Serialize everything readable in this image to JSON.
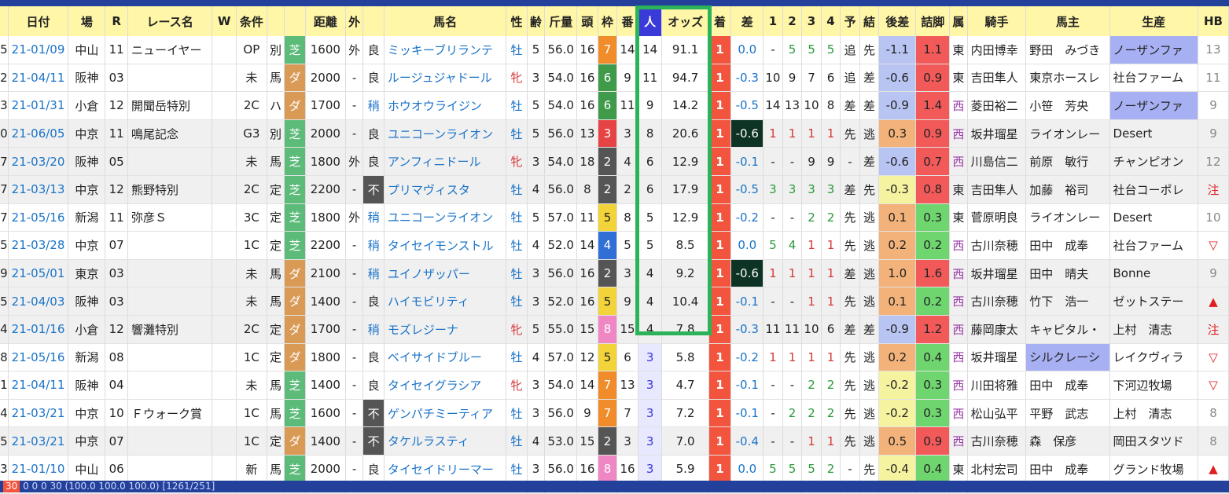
{
  "header": {
    "cols": [
      "",
      "日付",
      "場",
      "R",
      "レース名",
      "W",
      "条件",
      "",
      "",
      "距離",
      "外",
      "",
      "馬名",
      "性",
      "齢",
      "斤量",
      "頭",
      "枠",
      "番",
      "人",
      "オッズ",
      "着",
      "差",
      "1",
      "2",
      "3",
      "4",
      "予",
      "結",
      "後差",
      "詰脚",
      "属",
      "騎手",
      "馬主",
      "生産",
      "HB"
    ]
  },
  "rows": [
    {
      "i": "5",
      "date": "21-01/09",
      "place": "中山",
      "r": "11",
      "race": "ニューイヤー",
      "w": "",
      "cls": "OP",
      "cond": "別",
      "trk": "芝",
      "dist": "1600",
      "out": "外",
      "baba": "良",
      "horse": "ミッキーブリランテ",
      "sex": "牡",
      "age": "5",
      "kin": "56.0",
      "tou": "16",
      "waku": "7",
      "ban": "14",
      "nin": "14",
      "odds": "91.1",
      "chaku": "1",
      "sa": "0.0",
      "p1": "-",
      "p2": "5",
      "p3": "5",
      "p4": "5",
      "yo": "追",
      "ke": "先",
      "kosa": "-1.1",
      "tsume": "1.1",
      "zoku": "東",
      "jockey": "内田博幸",
      "owner": "野田　みづき",
      "breeder": "ノーザンファ",
      "hb": "13"
    },
    {
      "i": "2",
      "date": "21-04/11",
      "place": "阪神",
      "r": "03",
      "race": "",
      "w": "",
      "cls": "未",
      "cond": "馬",
      "trk": "ダ",
      "dist": "2000",
      "out": "-",
      "baba": "良",
      "horse": "ルージュジャドール",
      "sex": "牝",
      "age": "3",
      "kin": "54.0",
      "tou": "16",
      "waku": "6",
      "ban": "9",
      "nin": "11",
      "odds": "94.7",
      "chaku": "1",
      "sa": "-0.3",
      "p1": "10",
      "p2": "9",
      "p3": "7",
      "p4": "6",
      "yo": "追",
      "ke": "差",
      "kosa": "-0.6",
      "tsume": "0.9",
      "zoku": "東",
      "jockey": "吉田隼人",
      "owner": "東京ホースレ",
      "breeder": "社台ファーム",
      "hb": "11"
    },
    {
      "i": "3",
      "date": "21-01/31",
      "place": "小倉",
      "r": "12",
      "race": "開聞岳特別",
      "w": "",
      "cls": "2C",
      "cond": "ハ",
      "trk": "ダ",
      "dist": "1700",
      "out": "-",
      "baba": "稍",
      "horse": "ホウオウライジン",
      "sex": "牡",
      "age": "5",
      "kin": "54.0",
      "tou": "16",
      "waku": "6",
      "ban": "11",
      "nin": "9",
      "odds": "14.2",
      "chaku": "1",
      "sa": "-0.5",
      "p1": "14",
      "p2": "13",
      "p3": "10",
      "p4": "8",
      "yo": "差",
      "ke": "差",
      "kosa": "-0.9",
      "tsume": "1.4",
      "zoku": "西",
      "jockey": "菱田裕二",
      "owner": "小笹　芳央",
      "breeder": "ノーザンファ",
      "hb": "9"
    },
    {
      "i": "0",
      "date": "21-06/05",
      "place": "中京",
      "r": "11",
      "race": "鳴尾記念",
      "w": "",
      "cls": "G3",
      "cond": "別",
      "trk": "芝",
      "dist": "2000",
      "out": "-",
      "baba": "良",
      "horse": "ユニコーンライオン",
      "sex": "牡",
      "age": "5",
      "kin": "56.0",
      "tou": "13",
      "waku": "3",
      "ban": "3",
      "nin": "8",
      "odds": "20.6",
      "chaku": "1",
      "sa": "-0.6",
      "p1": "1",
      "p2": "1",
      "p3": "1",
      "p4": "1",
      "yo": "先",
      "ke": "逃",
      "kosa": "0.3",
      "tsume": "0.9",
      "zoku": "西",
      "jockey": "坂井瑠星",
      "owner": "ライオンレー",
      "breeder": "Desert",
      "hb": "9"
    },
    {
      "i": "7",
      "date": "21-03/20",
      "place": "阪神",
      "r": "05",
      "race": "",
      "w": "",
      "cls": "未",
      "cond": "馬",
      "trk": "芝",
      "dist": "1800",
      "out": "外",
      "baba": "良",
      "horse": "アンフィニドール",
      "sex": "牝",
      "age": "3",
      "kin": "54.0",
      "tou": "18",
      "waku": "2",
      "ban": "4",
      "nin": "6",
      "odds": "12.9",
      "chaku": "1",
      "sa": "-0.1",
      "p1": "-",
      "p2": "-",
      "p3": "9",
      "p4": "9",
      "yo": "-",
      "ke": "差",
      "kosa": "-0.6",
      "tsume": "0.7",
      "zoku": "西",
      "jockey": "川島信二",
      "owner": "前原　敏行",
      "breeder": "チャンピオン",
      "hb": "12"
    },
    {
      "i": "7",
      "date": "21-03/13",
      "place": "中京",
      "r": "12",
      "race": "熊野特別",
      "w": "",
      "cls": "2C",
      "cond": "定",
      "trk": "芝",
      "dist": "2200",
      "out": "-",
      "baba": "不",
      "horse": "プリマヴィスタ",
      "sex": "牡",
      "age": "4",
      "kin": "56.0",
      "tou": "8",
      "waku": "2",
      "ban": "2",
      "nin": "6",
      "odds": "17.9",
      "chaku": "1",
      "sa": "-0.5",
      "p1": "3",
      "p2": "3",
      "p3": "3",
      "p4": "3",
      "yo": "差",
      "ke": "先",
      "kosa": "-0.3",
      "tsume": "0.8",
      "zoku": "東",
      "jockey": "吉田隼人",
      "owner": "加藤　裕司",
      "breeder": "社台コーポレ",
      "hb": "注"
    },
    {
      "i": "7",
      "date": "21-05/16",
      "place": "新潟",
      "r": "11",
      "race": "弥彦Ｓ",
      "w": "",
      "cls": "3C",
      "cond": "定",
      "trk": "芝",
      "dist": "1800",
      "out": "外",
      "baba": "稍",
      "horse": "ユニコーンライオン",
      "sex": "牡",
      "age": "5",
      "kin": "57.0",
      "tou": "11",
      "waku": "5",
      "ban": "8",
      "nin": "5",
      "odds": "12.9",
      "chaku": "1",
      "sa": "-0.2",
      "p1": "-",
      "p2": "-",
      "p3": "2",
      "p4": "2",
      "yo": "先",
      "ke": "逃",
      "kosa": "0.1",
      "tsume": "0.3",
      "zoku": "東",
      "jockey": "菅原明良",
      "owner": "ライオンレー",
      "breeder": "Desert",
      "hb": "10"
    },
    {
      "i": "5",
      "date": "21-03/28",
      "place": "中京",
      "r": "07",
      "race": "",
      "w": "",
      "cls": "1C",
      "cond": "定",
      "trk": "芝",
      "dist": "2200",
      "out": "-",
      "baba": "稍",
      "horse": "タイセイモンストル",
      "sex": "牡",
      "age": "4",
      "kin": "52.0",
      "tou": "14",
      "waku": "4",
      "ban": "5",
      "nin": "5",
      "odds": "8.5",
      "chaku": "1",
      "sa": "0.0",
      "p1": "5",
      "p2": "4",
      "p3": "1",
      "p4": "1",
      "yo": "先",
      "ke": "逃",
      "kosa": "0.2",
      "tsume": "0.2",
      "zoku": "西",
      "jockey": "古川奈穂",
      "owner": "田中　成奉",
      "breeder": "社台ファーム",
      "hb": "▽"
    },
    {
      "i": "9",
      "date": "21-05/01",
      "place": "東京",
      "r": "03",
      "race": "",
      "w": "",
      "cls": "未",
      "cond": "馬",
      "trk": "ダ",
      "dist": "2100",
      "out": "-",
      "baba": "稍",
      "horse": "ユイノザッパー",
      "sex": "牡",
      "age": "3",
      "kin": "56.0",
      "tou": "16",
      "waku": "2",
      "ban": "3",
      "nin": "4",
      "odds": "9.2",
      "chaku": "1",
      "sa": "-0.6",
      "p1": "1",
      "p2": "1",
      "p3": "1",
      "p4": "1",
      "yo": "差",
      "ke": "逃",
      "kosa": "1.0",
      "tsume": "1.6",
      "zoku": "西",
      "jockey": "坂井瑠星",
      "owner": "田中　晴夫",
      "breeder": "Bonne",
      "hb": "9"
    },
    {
      "i": "5",
      "date": "21-04/03",
      "place": "阪神",
      "r": "03",
      "race": "",
      "w": "",
      "cls": "未",
      "cond": "馬",
      "trk": "ダ",
      "dist": "1400",
      "out": "-",
      "baba": "良",
      "horse": "ハイモビリティ",
      "sex": "牡",
      "age": "3",
      "kin": "52.0",
      "tou": "16",
      "waku": "5",
      "ban": "9",
      "nin": "4",
      "odds": "10.4",
      "chaku": "1",
      "sa": "-0.1",
      "p1": "-",
      "p2": "-",
      "p3": "1",
      "p4": "1",
      "yo": "先",
      "ke": "逃",
      "kosa": "0.1",
      "tsume": "0.2",
      "zoku": "西",
      "jockey": "古川奈穂",
      "owner": "竹下　浩一",
      "breeder": "ゼットステー",
      "hb": "▲"
    },
    {
      "i": "4",
      "date": "21-01/16",
      "place": "小倉",
      "r": "12",
      "race": "響灘特別",
      "w": "",
      "cls": "2C",
      "cond": "定",
      "trk": "ダ",
      "dist": "1700",
      "out": "-",
      "baba": "稍",
      "horse": "モズレジーナ",
      "sex": "牝",
      "age": "5",
      "kin": "55.0",
      "tou": "15",
      "waku": "8",
      "ban": "15",
      "nin": "4",
      "odds": "7.8",
      "chaku": "1",
      "sa": "-0.3",
      "p1": "11",
      "p2": "11",
      "p3": "10",
      "p4": "6",
      "yo": "差",
      "ke": "差",
      "kosa": "-0.9",
      "tsume": "1.2",
      "zoku": "西",
      "jockey": "藤岡康太",
      "owner": "キャピタル・",
      "breeder": "上村　清志",
      "hb": "注"
    },
    {
      "i": "8",
      "date": "21-05/16",
      "place": "新潟",
      "r": "08",
      "race": "",
      "w": "",
      "cls": "1C",
      "cond": "定",
      "trk": "ダ",
      "dist": "1800",
      "out": "-",
      "baba": "良",
      "horse": "ベイサイドブルー",
      "sex": "牡",
      "age": "4",
      "kin": "57.0",
      "tou": "12",
      "waku": "5",
      "ban": "6",
      "nin": "3",
      "odds": "5.8",
      "chaku": "1",
      "sa": "-0.2",
      "p1": "1",
      "p2": "1",
      "p3": "1",
      "p4": "1",
      "yo": "先",
      "ke": "逃",
      "kosa": "0.2",
      "tsume": "0.4",
      "zoku": "西",
      "jockey": "坂井瑠星",
      "owner": "シルクレーシ",
      "breeder": "レイクヴィラ",
      "hb": "▽"
    },
    {
      "i": "1",
      "date": "21-04/11",
      "place": "阪神",
      "r": "04",
      "race": "",
      "w": "",
      "cls": "未",
      "cond": "馬",
      "trk": "芝",
      "dist": "1400",
      "out": "-",
      "baba": "良",
      "horse": "タイセイグラシア",
      "sex": "牝",
      "age": "3",
      "kin": "54.0",
      "tou": "14",
      "waku": "7",
      "ban": "13",
      "nin": "3",
      "odds": "4.7",
      "chaku": "1",
      "sa": "-0.1",
      "p1": "-",
      "p2": "-",
      "p3": "2",
      "p4": "2",
      "yo": "先",
      "ke": "逃",
      "kosa": "-0.2",
      "tsume": "0.3",
      "zoku": "西",
      "jockey": "川田将雅",
      "owner": "田中　成奉",
      "breeder": "下河辺牧場",
      "hb": "▽"
    },
    {
      "i": "4",
      "date": "21-03/21",
      "place": "中京",
      "r": "10",
      "race": "Ｆウォーク賞",
      "w": "",
      "cls": "1C",
      "cond": "馬",
      "trk": "芝",
      "dist": "1600",
      "out": "-",
      "baba": "不",
      "horse": "ゲンパチミーティア",
      "sex": "牡",
      "age": "3",
      "kin": "56.0",
      "tou": "9",
      "waku": "7",
      "ban": "7",
      "nin": "3",
      "odds": "7.2",
      "chaku": "1",
      "sa": "-0.1",
      "p1": "-",
      "p2": "2",
      "p3": "2",
      "p4": "2",
      "yo": "先",
      "ke": "逃",
      "kosa": "-0.2",
      "tsume": "0.3",
      "zoku": "西",
      "jockey": "松山弘平",
      "owner": "平野　武志",
      "breeder": "上村　清志",
      "hb": "8"
    },
    {
      "i": "5",
      "date": "21-03/21",
      "place": "中京",
      "r": "07",
      "race": "",
      "w": "",
      "cls": "1C",
      "cond": "定",
      "trk": "ダ",
      "dist": "1400",
      "out": "-",
      "baba": "不",
      "horse": "タケルラスティ",
      "sex": "牡",
      "age": "4",
      "kin": "53.0",
      "tou": "15",
      "waku": "2",
      "ban": "3",
      "nin": "3",
      "odds": "7.0",
      "chaku": "1",
      "sa": "-0.4",
      "p1": "-",
      "p2": "-",
      "p3": "1",
      "p4": "1",
      "yo": "先",
      "ke": "逃",
      "kosa": "0.5",
      "tsume": "0.9",
      "zoku": "西",
      "jockey": "古川奈穂",
      "owner": "森　保彦",
      "breeder": "岡田スタツド",
      "hb": "8"
    },
    {
      "i": "3",
      "date": "21-01/10",
      "place": "中山",
      "r": "06",
      "race": "",
      "w": "",
      "cls": "新",
      "cond": "馬",
      "trk": "芝",
      "dist": "2000",
      "out": "-",
      "baba": "良",
      "horse": "タイセイドリーマー",
      "sex": "牡",
      "age": "3",
      "kin": "56.0",
      "tou": "16",
      "waku": "8",
      "ban": "16",
      "nin": "3",
      "odds": "5.9",
      "chaku": "1",
      "sa": "0.0",
      "p1": "5",
      "p2": "5",
      "p3": "5",
      "p4": "2",
      "yo": "-",
      "ke": "先",
      "kosa": "-0.4",
      "tsume": "0.4",
      "zoku": "東",
      "jockey": "北村宏司",
      "owner": "田中　成奉",
      "breeder": "グランド牧場",
      "hb": "▲"
    }
  ],
  "footer": {
    "chip": "30",
    "text": "0 0 0 30 (100.0 100.0 100.0) [1261/251]"
  },
  "colors": {
    "highlight": "#2bb35a",
    "header_bg": "#fff6a8",
    "ninki_header": "#3a3ad8",
    "chaku": "#f2543d"
  }
}
